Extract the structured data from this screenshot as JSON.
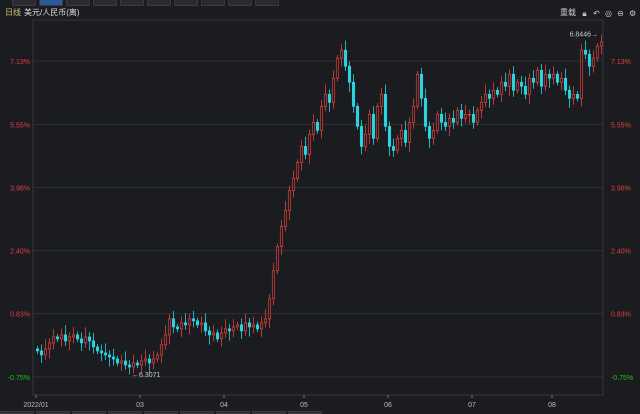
{
  "header": {
    "period": "日线",
    "symbol": "美元/人民币(离)",
    "reload": "重载",
    "icons": [
      "lock-icon",
      "undo-icon",
      "circle-icon",
      "minus-circle-icon",
      "gear-icon"
    ]
  },
  "colors": {
    "up": "#e0403c",
    "down": "#2ad3e0",
    "grid": "#2e3036",
    "pos_label": "#e0403c",
    "neg_label": "#19c819"
  },
  "chart_data": {
    "type": "candlestick",
    "title": "美元/人民币(离)",
    "y_unit": "percent",
    "ylim": [
      -0.75,
      7.13
    ],
    "y_ticks": [
      "7.13%",
      "5.55%",
      "3.98%",
      "2.40%",
      "0.83%",
      "-0.75%"
    ],
    "y_tick_values": [
      7.13,
      5.55,
      3.98,
      2.4,
      0.83,
      -0.75
    ],
    "x_ticks": [
      "2022/01",
      "03",
      "04",
      "05",
      "06",
      "07",
      "08"
    ],
    "x_tick_index": [
      0,
      26,
      47,
      67,
      88,
      109,
      129
    ],
    "annotations": {
      "max": "6.8446",
      "min": "6.3071",
      "max_index": 141,
      "min_index": 23
    },
    "start_pct": -0.05,
    "close_pct": [
      -0.1,
      -0.2,
      -0.05,
      0.1,
      0.25,
      0.2,
      0.3,
      0.15,
      0.25,
      0.3,
      0.2,
      0.1,
      0.25,
      0.15,
      0.0,
      -0.1,
      -0.15,
      -0.2,
      -0.25,
      -0.3,
      -0.4,
      -0.35,
      -0.45,
      -0.5,
      -0.4,
      -0.45,
      -0.35,
      -0.3,
      -0.4,
      -0.3,
      -0.2,
      0.05,
      0.3,
      0.7,
      0.5,
      0.45,
      0.6,
      0.55,
      0.7,
      0.65,
      0.55,
      0.6,
      0.4,
      0.3,
      0.35,
      0.2,
      0.35,
      0.45,
      0.4,
      0.5,
      0.55,
      0.4,
      0.6,
      0.5,
      0.55,
      0.45,
      0.6,
      0.7,
      1.2,
      1.9,
      2.5,
      3.0,
      3.4,
      3.9,
      4.2,
      4.6,
      5.0,
      4.8,
      5.3,
      5.6,
      5.4,
      6.0,
      6.3,
      6.1,
      6.7,
      7.2,
      7.4,
      7.0,
      6.6,
      6.0,
      5.5,
      5.0,
      5.3,
      5.8,
      5.2,
      6.0,
      6.3,
      5.5,
      5.0,
      4.9,
      5.2,
      5.4,
      5.1,
      5.6,
      6.0,
      6.8,
      6.2,
      5.5,
      5.2,
      5.4,
      5.8,
      5.6,
      5.5,
      5.7,
      5.6,
      5.9,
      5.7,
      5.8,
      5.8,
      5.6,
      5.9,
      6.1,
      6.3,
      6.2,
      6.4,
      6.3,
      6.6,
      6.5,
      6.8,
      6.4,
      6.6,
      6.5,
      6.3,
      6.7,
      6.6,
      6.9,
      6.5,
      6.8,
      6.7,
      6.8,
      6.6,
      6.7,
      6.4,
      6.2,
      6.3,
      6.2,
      7.4,
      7.3,
      7.0,
      7.2,
      7.5,
      7.6
    ]
  }
}
